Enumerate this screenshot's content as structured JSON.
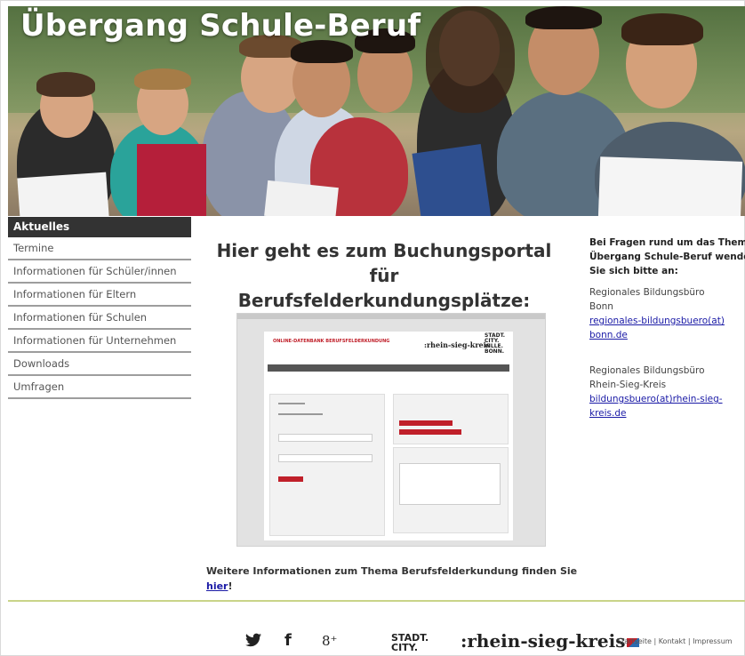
{
  "header": {
    "title": "Übergang Schule-Beruf"
  },
  "sidebar": {
    "heading": "Aktuelles",
    "items": [
      {
        "label": "Termine"
      },
      {
        "label": "Informationen für Schüler/innen"
      },
      {
        "label": "Informationen für Eltern"
      },
      {
        "label": "Informationen für Schulen"
      },
      {
        "label": "Informationen für Unternehmen"
      },
      {
        "label": "Downloads"
      },
      {
        "label": "Umfragen"
      }
    ]
  },
  "main": {
    "title_line1": "Hier geht es zum Buchungsportal für",
    "title_line2": "Berufsfelderkundungsplätze:",
    "portal_title": "ONLINE-DATENBANK BERUFSFELDERKUNDUNG",
    "portal_logo_rsk": ":rhein-sieg-kreis",
    "portal_logo_bonn": "STADT. CITY. VILLE. BONN.",
    "more_info_text": "Weitere Informationen zum Thema Berufsfelderkundung finden Sie",
    "more_info_link": "hier",
    "more_info_suffix": "!"
  },
  "right": {
    "question": "Bei Fragen rund um das Thema Übergang Schule-Beruf wenden Sie sich bitte an:",
    "question_line1": "Bei Fragen rund um das Thema",
    "question_line2": "Übergang Schule-Beruf wenden",
    "question_line3": "Sie sich bitte an:",
    "contact1_name_line1": "Regionales Bildungsbüro",
    "contact1_name_line2": "Bonn",
    "contact1_email_line1": "regionales-bildungsbuero(at)",
    "contact1_email_line2": "bonn.de",
    "contact2_name_line1": "Regionales Bildungsbüro",
    "contact2_name_line2": "Rhein-Sieg-Kreis",
    "contact2_email_line1": "bildungsbuero(at)rhein-sieg-",
    "contact2_email_line2": "kreis.de"
  },
  "footer": {
    "social_twitter": "🐦",
    "social_facebook": "f",
    "social_google": "8⁺",
    "logo_bonn_line1": "STADT.",
    "logo_bonn_line2": "CITY.",
    "logo_rsk": ":rhein-sieg-kreis",
    "links": "Startseite | Kontakt | Impressum"
  },
  "colors": {
    "sidebar_head": "#333333",
    "accent_red": "#c0202a",
    "link": "#1a1aa6",
    "footer_line": "#c9d489"
  }
}
